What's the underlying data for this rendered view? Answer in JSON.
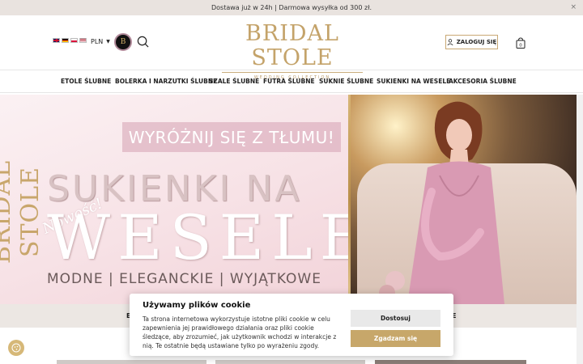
{
  "topbar": {
    "text": "Dostawa już w 24h | Darmowa wysyłka od 300 zł.",
    "close": "×"
  },
  "header": {
    "flags": [
      "gb-flag-icon",
      "de-flag-icon",
      "pl-flag-icon",
      "us-flag-icon"
    ],
    "currency": "PLN",
    "badge_letter": "B",
    "logo_brand": "BRIDAL STOLE",
    "logo_sub": "WEDDING COLLECTION",
    "login_label": "ZALOGUJ SIĘ",
    "cart_count": "0"
  },
  "nav": {
    "items": [
      "ETOLE ŚLUBNE",
      "BOLERKA I NARZUTKI ŚLUBNE",
      "SZALE ŚLUBNE",
      "FUTRA ŚLUBNE",
      "SUKNIE ŚLUBNE",
      "SUKIENKI NA WESELE",
      "AKCESORIA ŚLUBNE"
    ]
  },
  "hero": {
    "vertical_logo": "BRIDAL STOLE",
    "script": "Nowość!",
    "banner": "WYRÓŻNIJ SIĘ Z TŁUMU!",
    "headline_1": "SUKIENKI NA",
    "headline_2": "WESELE",
    "tagline": "MODNE | ELEGANCKIE | WYJĄTKOWE"
  },
  "strip": {
    "left_fragment": "E",
    "right_fragment": "E"
  },
  "cookie": {
    "title": "Używamy plików cookie",
    "body": "Ta strona internetowa wykorzystuje istotne pliki cookie w celu zapewnienia jej prawidłowego działania oraz pliki cookie śledzące, aby zrozumieć, jak użytkownik wchodzi w interakcje z nią. Te ostatnie będą ustawiane tylko po wyrażeniu zgody.",
    "customize_label": "Dostosuj",
    "accept_label": "Zgadzam się"
  },
  "colors": {
    "accent_gold": "#c7a76a",
    "topbar_bg": "#e9e3df",
    "hero_pink": "#f7e2e6"
  }
}
